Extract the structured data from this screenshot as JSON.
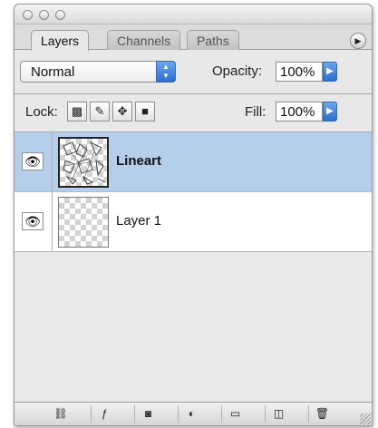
{
  "tabs": [
    {
      "label": "Layers",
      "active": true
    },
    {
      "label": "Channels",
      "active": false
    },
    {
      "label": "Paths",
      "active": false
    }
  ],
  "blend_mode": {
    "value": "Normal"
  },
  "opacity": {
    "label": "Opacity:",
    "value": "100%"
  },
  "lock": {
    "label": "Lock:"
  },
  "fill": {
    "label": "Fill:",
    "value": "100%"
  },
  "layers": [
    {
      "name": "Lineart",
      "selected": true,
      "visible": true
    },
    {
      "name": "Layer 1",
      "selected": false,
      "visible": true
    }
  ],
  "colors": {
    "selected_row": "#b5cfeb",
    "accent": "#2b6fd0"
  },
  "icons": {
    "panel_menu": "panel-menu-icon",
    "lock_buttons": [
      "lock-transparency-icon",
      "lock-brush-icon",
      "lock-move-icon",
      "lock-all-icon"
    ],
    "bottom_buttons": [
      "link-icon",
      "layer-style-icon",
      "mask-icon",
      "adjustment-icon",
      "folder-icon",
      "new-layer-icon",
      "trash-icon"
    ]
  }
}
